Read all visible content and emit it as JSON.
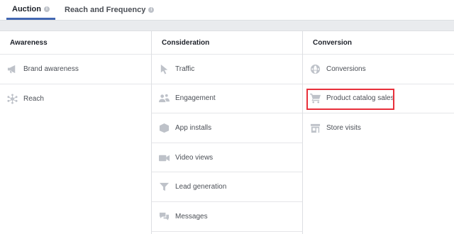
{
  "tabs": [
    {
      "label": "Auction",
      "info_icon": "info-icon"
    },
    {
      "label": "Reach and Frequency",
      "info_icon": "info-icon"
    }
  ],
  "columns": [
    {
      "title": "Awareness",
      "items": [
        {
          "label": "Brand awareness",
          "icon": "megaphone-icon"
        },
        {
          "label": "Reach",
          "icon": "reach-icon"
        }
      ]
    },
    {
      "title": "Consideration",
      "items": [
        {
          "label": "Traffic",
          "icon": "cursor-icon"
        },
        {
          "label": "Engagement",
          "icon": "people-icon"
        },
        {
          "label": "App installs",
          "icon": "box-icon"
        },
        {
          "label": "Video views",
          "icon": "video-camera-icon"
        },
        {
          "label": "Lead generation",
          "icon": "funnel-icon"
        },
        {
          "label": "Messages",
          "icon": "chat-bubbles-icon"
        }
      ]
    },
    {
      "title": "Conversion",
      "items": [
        {
          "label": "Conversions",
          "icon": "globe-icon"
        },
        {
          "label": "Product catalog sales",
          "icon": "cart-icon"
        },
        {
          "label": "Store visits",
          "icon": "store-icon"
        }
      ]
    }
  ],
  "colors": {
    "accent": "#4267b2",
    "highlight": "#e8303b",
    "icon": "#bec2c9"
  }
}
